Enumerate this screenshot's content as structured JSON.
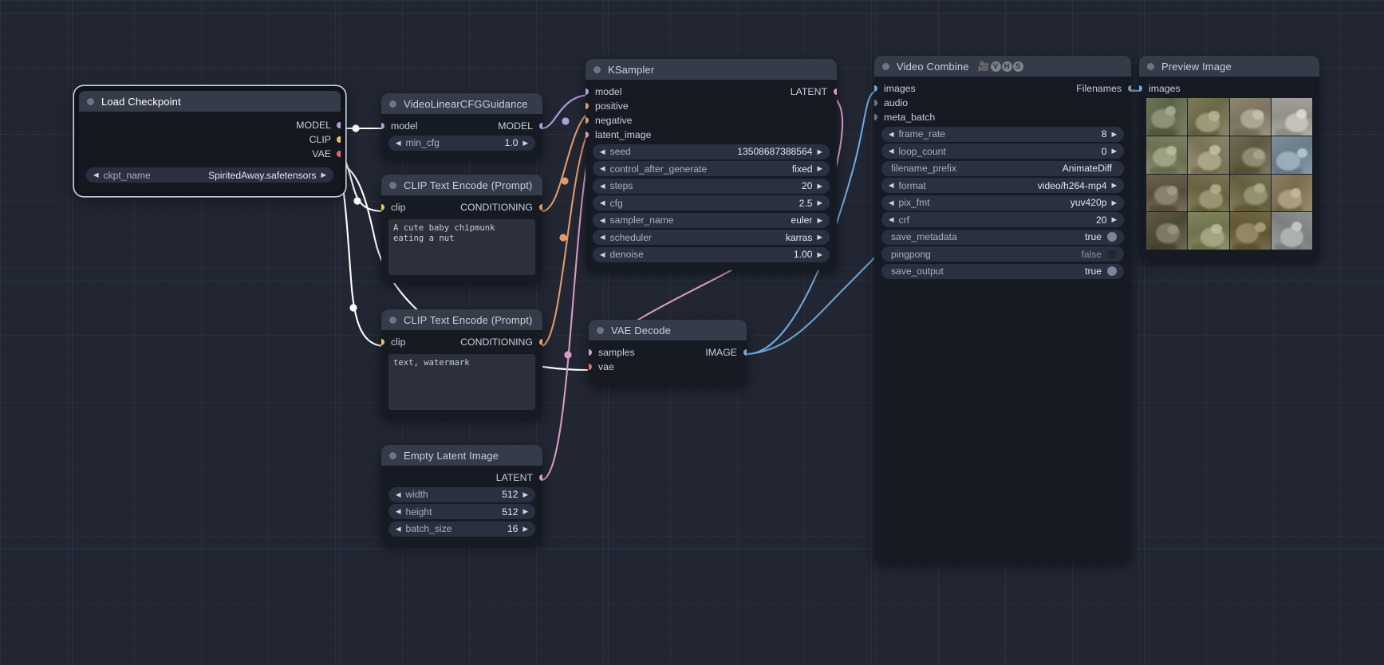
{
  "app": {
    "name": "ComfyUI",
    "canvas_bg": "#212632"
  },
  "nodes": [
    {
      "id": "load_checkpoint",
      "title": "Load Checkpoint",
      "selected": true,
      "outputs": [
        {
          "label": "MODEL",
          "color": "#b39ddb"
        },
        {
          "label": "CLIP",
          "color": "#e7c35b"
        },
        {
          "label": "VAE",
          "color": "#e06a6a"
        }
      ],
      "widgets": [
        {
          "name": "ckpt_name",
          "value": "SpiritedAway.safetensors",
          "arrows": true
        }
      ]
    },
    {
      "id": "video_linear_cfg",
      "title": "VideoLinearCFGGuidance",
      "inputs": [
        {
          "label": "model",
          "color": "#b39ddb"
        }
      ],
      "outputs": [
        {
          "label": "MODEL",
          "color": "#b39ddb"
        }
      ],
      "widgets": [
        {
          "name": "min_cfg",
          "value": "1.0",
          "arrows": true
        }
      ]
    },
    {
      "id": "clip_positive",
      "title": "CLIP Text Encode (Prompt)",
      "inputs": [
        {
          "label": "clip",
          "color": "#e7c35b"
        }
      ],
      "outputs": [
        {
          "label": "CONDITIONING",
          "color": "#e09a6e"
        }
      ],
      "text": "A cute baby chipmunk eating a nut"
    },
    {
      "id": "clip_negative",
      "title": "CLIP Text Encode (Prompt)",
      "inputs": [
        {
          "label": "clip",
          "color": "#e7c35b"
        }
      ],
      "outputs": [
        {
          "label": "CONDITIONING",
          "color": "#e09a6e"
        }
      ],
      "text": "text, watermark"
    },
    {
      "id": "empty_latent",
      "title": "Empty Latent Image",
      "outputs": [
        {
          "label": "LATENT",
          "color": "#d99ac4"
        }
      ],
      "widgets": [
        {
          "name": "width",
          "value": "512",
          "arrows": true
        },
        {
          "name": "height",
          "value": "512",
          "arrows": true
        },
        {
          "name": "batch_size",
          "value": "16",
          "arrows": true
        }
      ]
    },
    {
      "id": "ksampler",
      "title": "KSampler",
      "inputs": [
        {
          "label": "model",
          "color": "#b39ddb"
        },
        {
          "label": "positive",
          "color": "#e09a6e"
        },
        {
          "label": "negative",
          "color": "#e09a6e"
        },
        {
          "label": "latent_image",
          "color": "#d99ac4"
        }
      ],
      "outputs": [
        {
          "label": "LATENT",
          "color": "#d99ac4"
        }
      ],
      "widgets": [
        {
          "name": "seed",
          "value": "13508687388564",
          "arrows": true
        },
        {
          "name": "control_after_generate",
          "value": "fixed",
          "arrows": true
        },
        {
          "name": "steps",
          "value": "20",
          "arrows": true
        },
        {
          "name": "cfg",
          "value": "2.5",
          "arrows": true
        },
        {
          "name": "sampler_name",
          "value": "euler",
          "arrows": true
        },
        {
          "name": "scheduler",
          "value": "karras",
          "arrows": true
        },
        {
          "name": "denoise",
          "value": "1.00",
          "arrows": true
        }
      ]
    },
    {
      "id": "vae_decode",
      "title": "VAE Decode",
      "inputs": [
        {
          "label": "samples",
          "color": "#d99ac4"
        },
        {
          "label": "vae",
          "color": "#e06a6a"
        }
      ],
      "outputs": [
        {
          "label": "IMAGE",
          "color": "#6fa8dc"
        }
      ]
    },
    {
      "id": "video_combine",
      "title": "Video Combine",
      "badges": [
        "camera",
        "V",
        "H",
        "S"
      ],
      "inputs": [
        {
          "label": "images",
          "color": "#6fa8dc"
        },
        {
          "label": "audio",
          "color": "#6d7486"
        },
        {
          "label": "meta_batch",
          "color": "#6d7486"
        }
      ],
      "outputs": [
        {
          "label": "Filenames",
          "color": "#8d94a4"
        }
      ],
      "widgets": [
        {
          "name": "frame_rate",
          "value": "8",
          "arrows": true
        },
        {
          "name": "loop_count",
          "value": "0",
          "arrows": true
        },
        {
          "name": "filename_prefix",
          "value": "AnimateDiff",
          "arrows": false
        },
        {
          "name": "format",
          "value": "video/h264-mp4",
          "arrows": true
        },
        {
          "name": "pix_fmt",
          "value": "yuv420p",
          "arrows": true
        },
        {
          "name": "crf",
          "value": "20",
          "arrows": true
        },
        {
          "name": "save_metadata",
          "value": "true",
          "arrows": false,
          "toggle": "on"
        },
        {
          "name": "pingpong",
          "value": "false",
          "arrows": false,
          "toggle": "off"
        },
        {
          "name": "save_output",
          "value": "true",
          "arrows": false,
          "toggle": "on"
        }
      ]
    },
    {
      "id": "preview_image",
      "title": "Preview Image",
      "inputs": [
        {
          "label": "images",
          "color": "#6fa8dc"
        }
      ],
      "preview_grid": {
        "rows": 4,
        "cols": 4,
        "cells": [
          "#6d7357",
          "#7d7a5c",
          "#8d8672",
          "#a3a199",
          "#7d8263",
          "#8a8468",
          "#6f6a52",
          "#7d8e9b",
          "#6b6050",
          "#7a7452",
          "#76714f",
          "#8a7f63",
          "#5f5a46",
          "#82845f",
          "#726845",
          "#8e9192"
        ]
      }
    }
  ]
}
